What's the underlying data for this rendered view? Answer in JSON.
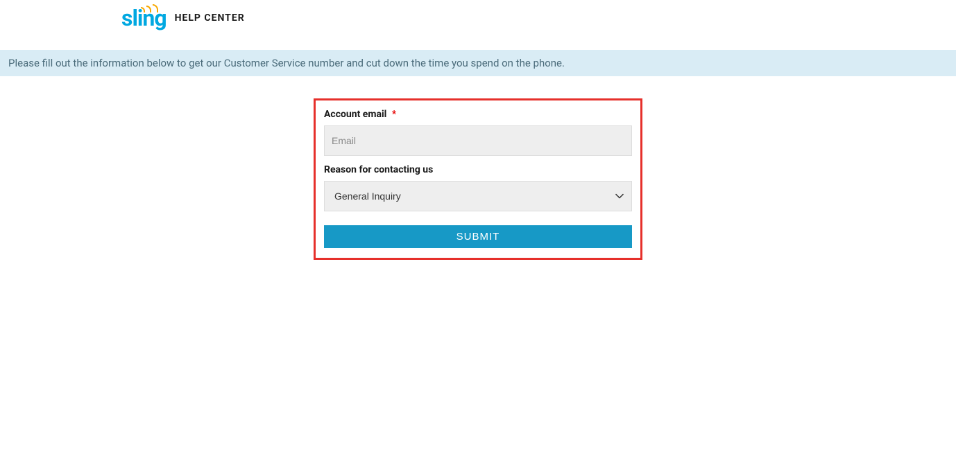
{
  "header": {
    "logo_text": "sling",
    "help_center_label": "HELP CENTER"
  },
  "banner": {
    "message": "Please fill out the information below to get our Customer Service number and cut down the time you spend on the phone."
  },
  "form": {
    "email_label": "Account email",
    "email_placeholder": "Email",
    "email_value": "",
    "reason_label": "Reason for contacting us",
    "reason_selected": "General Inquiry",
    "submit_label": "SUBMIT"
  }
}
